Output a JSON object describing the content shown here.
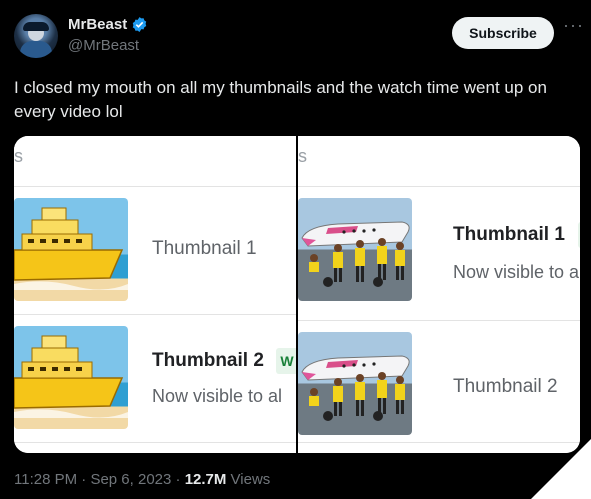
{
  "author": {
    "name": "MrBeast",
    "handle": "@MrBeast",
    "verified_color": "#1d9bf0"
  },
  "actions": {
    "subscribe_label": "Subscribe",
    "more_icon": "ellipsis-icon",
    "more_label": "···"
  },
  "tweet": {
    "text": "I closed my mouth on all my thumbnails and the watch time went up on every video lol"
  },
  "media": {
    "left": {
      "header_fragment": "s",
      "rows": [
        {
          "label": "Thumbnail 1",
          "image": "golden-ship"
        },
        {
          "label": "Thumbnail 2",
          "badge": "W",
          "subtext": "Now visible to al",
          "image": "golden-ship"
        }
      ]
    },
    "right": {
      "header_fragment": "s",
      "rows": [
        {
          "label": "Thumbnail 1",
          "badge": "V",
          "subtext": "Now visible to a",
          "image": "airplane-group"
        },
        {
          "label": "Thumbnail 2",
          "image": "airplane-group"
        }
      ]
    }
  },
  "meta": {
    "time": "11:28 PM",
    "sep1": " · ",
    "date": "Sep 6, 2023",
    "sep2": " · ",
    "views_count": "12.7M",
    "views_label": " Views"
  }
}
